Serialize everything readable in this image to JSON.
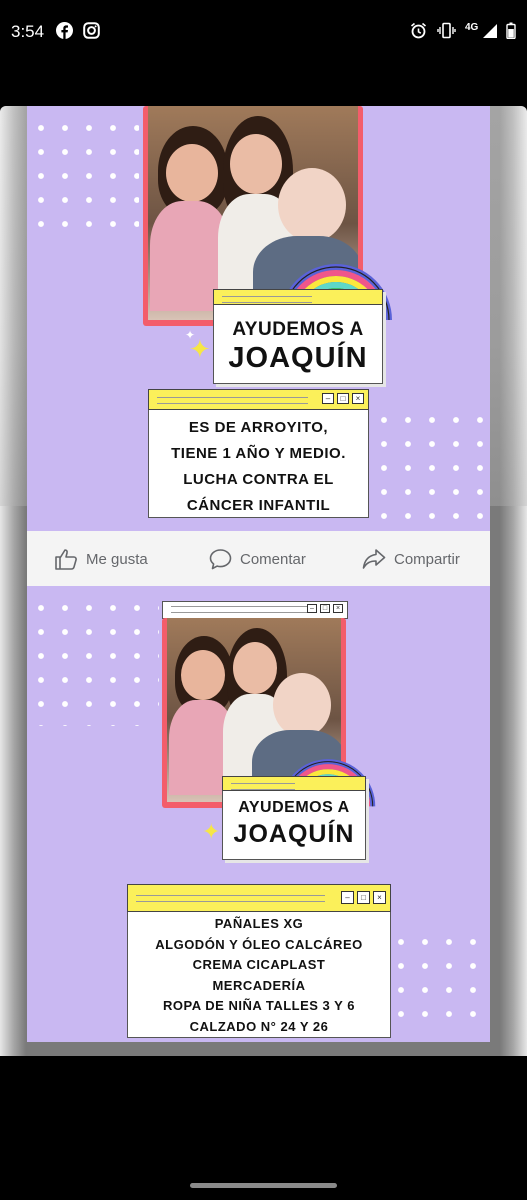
{
  "status_bar": {
    "time": "3:54",
    "network": "4G",
    "icons": [
      "facebook-icon",
      "instagram-icon",
      "alarm-icon",
      "vibrate-icon",
      "signal-icon",
      "battery-icon"
    ]
  },
  "post1": {
    "title_line1": "AYUDEMOS A",
    "title_line2": "JOAQUÍN",
    "info_lines": [
      "ES DE ARROYITO,",
      "TIENE 1 AÑO Y MEDIO.",
      "LUCHA CONTRA EL",
      "CÁNCER INFANTIL"
    ]
  },
  "actions": {
    "like": "Me gusta",
    "comment": "Comentar",
    "share": "Compartir"
  },
  "post2": {
    "title_line1": "AYUDEMOS A",
    "title_line2": "JOAQUÍN",
    "needs": [
      "PAÑALES XG",
      "ALGODÓN Y ÓLEO CALCÁREO",
      "CREMA CICAPLAST",
      "MERCADERÍA",
      "ROPA DE NIÑA TALLES 3 Y 6",
      "CALZADO N° 24 Y 26"
    ]
  },
  "colors": {
    "lavender": "#c9b8f2",
    "frame_red": "#f35d6b",
    "window_yellow": "#fbf05a"
  }
}
